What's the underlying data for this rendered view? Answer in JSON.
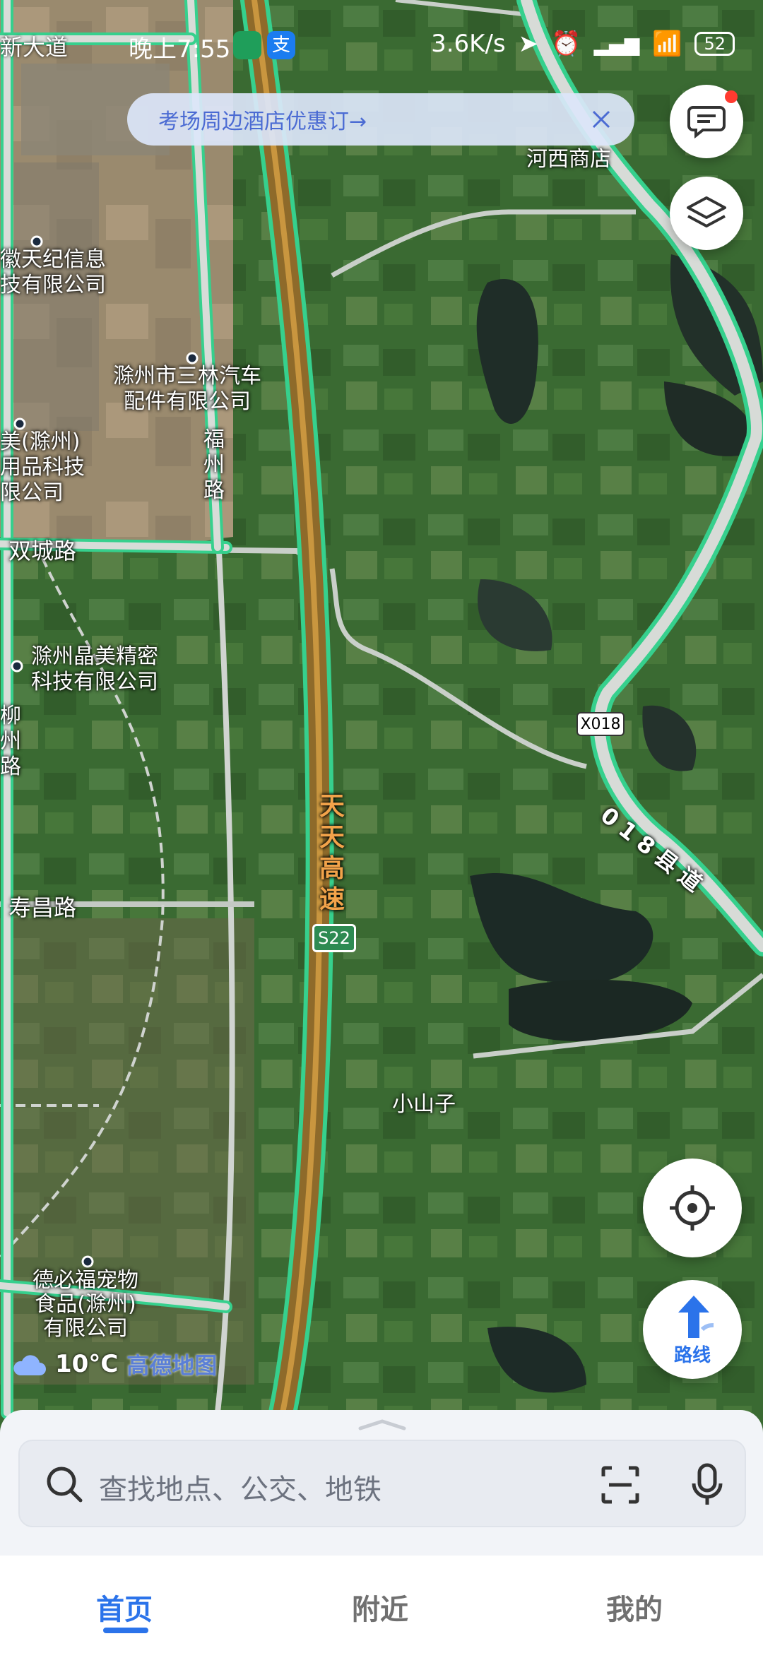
{
  "status": {
    "left_partial": "新大道",
    "time": "晚上7:55",
    "speed": "3.6K/s",
    "battery": "52"
  },
  "banner": {
    "text": "考场周边酒店优惠订→"
  },
  "map_labels": {
    "hexi_store": "河西商店",
    "tianji": "徽天纪信息\n技有限公司",
    "sanlin": "滁州市三林汽车\n配件有限公司",
    "fuzhou_road": "福\n州\n路",
    "partial_mei": "美(滁州)\n用品科技\n限公司",
    "shuangcheng_road": "双城路",
    "jingmei": "滁州晶美精密\n科技有限公司",
    "liu_partial": "柳\n州\n路",
    "tiantian": "天\n天\n高\n速",
    "s22": "S22",
    "x018": "X018",
    "county_road": "018县道",
    "shouchang_road": "寿昌路",
    "xiaoshanzi": "小山子",
    "debifu": "德必福宠物\n食品(滁州)\n有限公司"
  },
  "weather": {
    "temp": "10°C",
    "provider": "高德地图"
  },
  "buttons": {
    "route_label": "路线"
  },
  "search": {
    "placeholder": "查找地点、公交、地铁"
  },
  "tabs": [
    {
      "label": "首页",
      "active": true
    },
    {
      "label": "附近",
      "active": false
    },
    {
      "label": "我的",
      "active": false
    }
  ],
  "colors": {
    "accent": "#2b73ea",
    "road_green": "#36d08d",
    "highway": "#b6863c"
  }
}
